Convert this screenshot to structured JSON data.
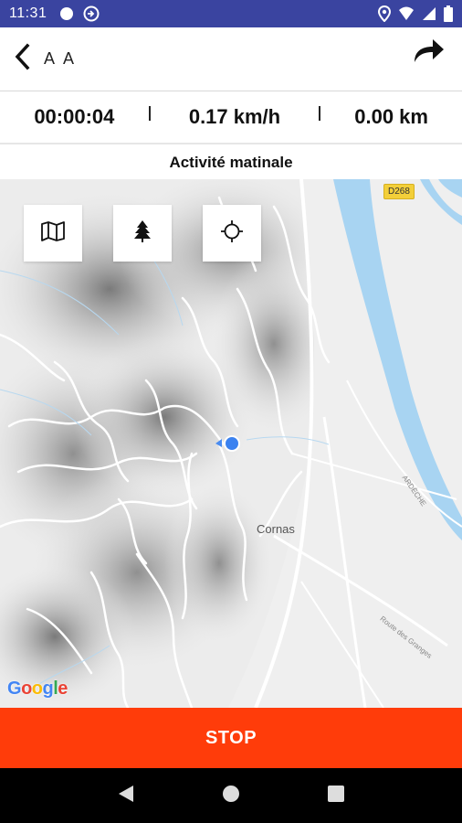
{
  "status_bar": {
    "time": "11:31",
    "bg_color": "#3a44a0"
  },
  "header": {
    "title": "A A",
    "back_icon": "chevron-left-icon",
    "share_icon": "share-arrow-icon"
  },
  "stats": {
    "duration": "00:00:04",
    "speed": "0.17 km/h",
    "distance": "0.00 km"
  },
  "activity": {
    "title": "Activité matinale"
  },
  "map": {
    "buttons": [
      {
        "icon": "map-icon"
      },
      {
        "icon": "tree-icon"
      },
      {
        "icon": "locate-icon"
      }
    ],
    "road_badge": "D268",
    "place_label": "Cornas",
    "road_label_1": "ARDÈCHE",
    "road_label_2": "Route des Granges",
    "attribution": "Google"
  },
  "stop_button": {
    "label": "STOP",
    "color": "#ff3c0a"
  },
  "nav_bar": {
    "back_icon": "nav-back-icon",
    "home_icon": "nav-home-icon",
    "recents_icon": "nav-recents-icon"
  }
}
